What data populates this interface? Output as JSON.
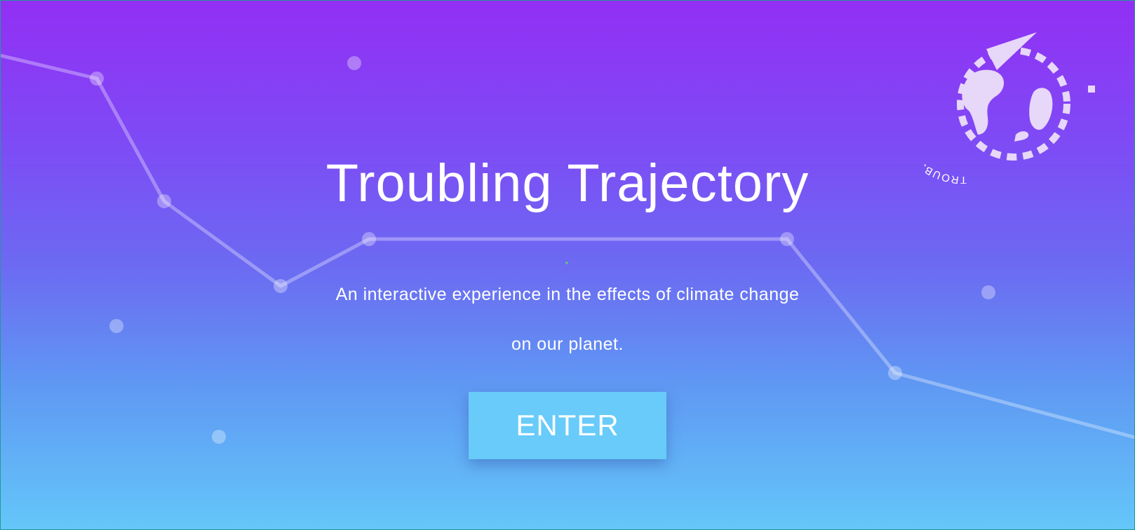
{
  "app": {
    "title": "Troubling Trajectory",
    "subtitle_line1": "An interactive experience in the effects of climate change",
    "subtitle_line2": "on our planet.",
    "enter_label": "ENTER"
  },
  "logo": {
    "ring_text": "TROUBLING TRAJECTORY",
    "icon": "globe-trajectory-logo-icon"
  },
  "colors": {
    "gradient_top": "#922ff4",
    "gradient_bottom": "#64c7f9",
    "button": "#68cbf9",
    "text": "#ffffff"
  }
}
